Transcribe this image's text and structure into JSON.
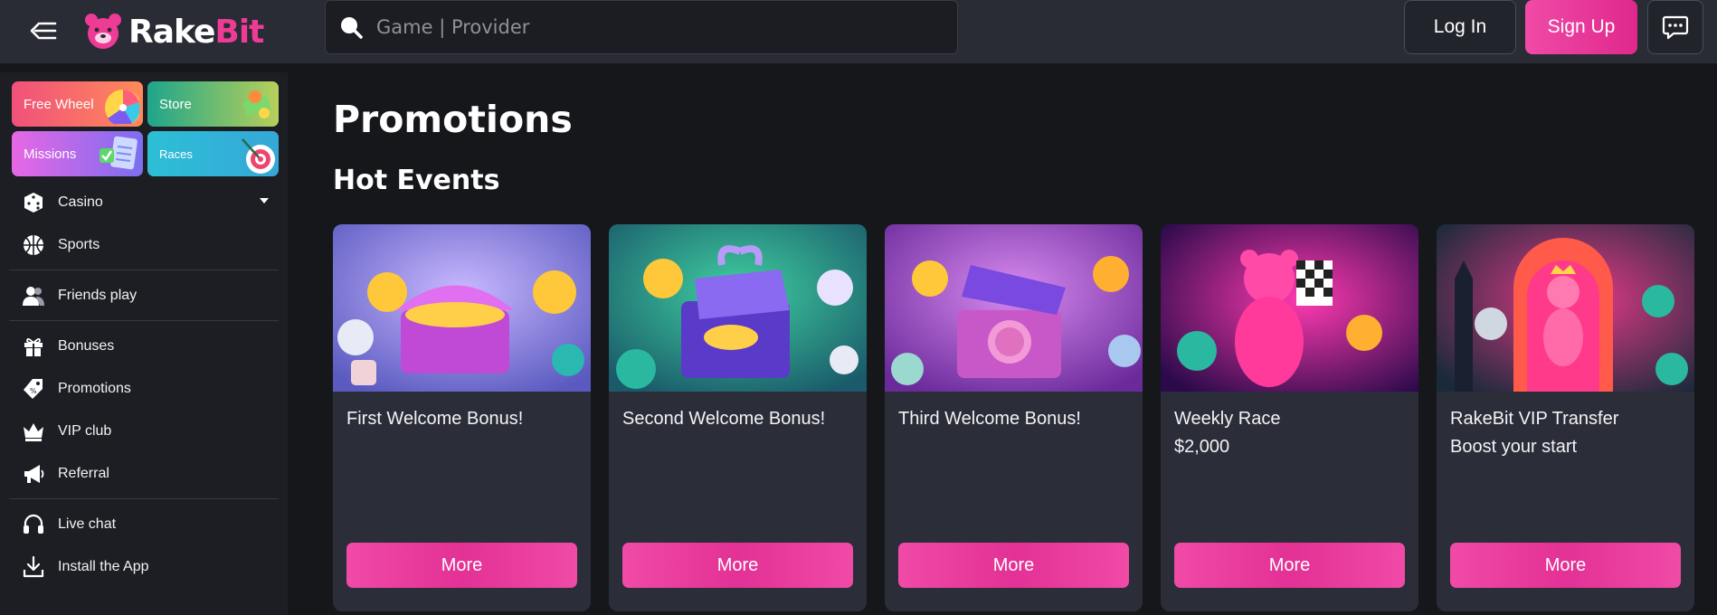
{
  "header": {
    "logo_rake": "Rake",
    "logo_bit": "Bit",
    "search_placeholder": "Game | Provider",
    "login_label": "Log In",
    "signup_label": "Sign Up"
  },
  "sidebar": {
    "tiles": [
      {
        "label": "Free Wheel"
      },
      {
        "label": "Store"
      },
      {
        "label": "Missions"
      },
      {
        "label": "Races"
      }
    ],
    "items": [
      {
        "label": "Casino",
        "icon": "dice-icon"
      },
      {
        "label": "Sports",
        "icon": "ball-icon"
      },
      {
        "label": "Friends play",
        "icon": "friends-icon"
      },
      {
        "label": "Bonuses",
        "icon": "gift-icon"
      },
      {
        "label": "Promotions",
        "icon": "tag-icon"
      },
      {
        "label": "VIP club",
        "icon": "crown-icon"
      },
      {
        "label": "Referral",
        "icon": "megaphone-icon"
      },
      {
        "label": "Live chat",
        "icon": "headset-icon"
      },
      {
        "label": "Install the App",
        "icon": "download-icon"
      }
    ]
  },
  "main": {
    "title": "Promotions",
    "section_title": "Hot Events",
    "cards": [
      {
        "title": "First Welcome Bonus!",
        "subtitle": "",
        "button": "More"
      },
      {
        "title": "Second Welcome Bonus!",
        "subtitle": "",
        "button": "More"
      },
      {
        "title": "Third Welcome Bonus!",
        "subtitle": "",
        "button": "More"
      },
      {
        "title": "Weekly Race",
        "subtitle": "$2,000",
        "button": "More"
      },
      {
        "title": "RakeBit VIP Transfer",
        "subtitle": "Boost your start",
        "button": "More"
      }
    ]
  },
  "colors": {
    "accent": "#ee3b96",
    "background": "#15171b",
    "header": "#2a2c35",
    "card": "#2b2d38"
  }
}
